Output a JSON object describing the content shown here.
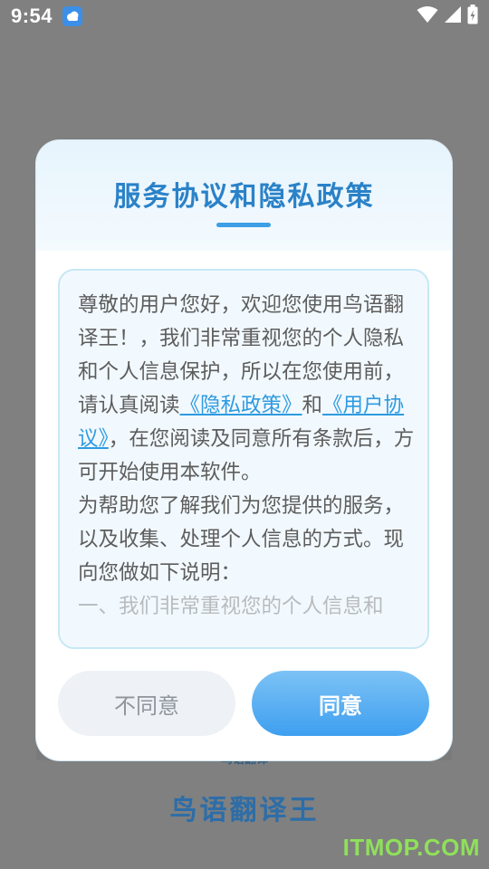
{
  "status_bar": {
    "time": "9:54",
    "icons": [
      "weather-cloud-icon",
      "wifi-icon",
      "signal-icon",
      "battery-icon"
    ]
  },
  "background": {
    "subtitle": "鸟语翻译",
    "app_name": "鸟语翻译王",
    "watermark": "ITMOP.COM"
  },
  "dialog": {
    "title": "服务协议和隐私政策",
    "content": {
      "intro_pre": "尊敬的用户您好，欢迎您使用鸟语翻译王！，我们非常重视您的个人隐私和个人信息保护，所以在您使用前，请认真阅读",
      "privacy_link": "《隐私政策》",
      "and": "和",
      "user_link": "《用户协议》",
      "intro_post": "，在您阅读及同意所有条款后，方可开始使用本软件。",
      "para2": "为帮助您了解我们为您提供的服务，以及收集、处理个人信息的方式。现向您做如下说明：",
      "para3": "一、我们非常重视您的个人信息和"
    },
    "buttons": {
      "disagree": "不同意",
      "agree": "同意"
    }
  },
  "colors": {
    "accent": "#3e9ff0",
    "title": "#2a82c8",
    "link": "#2e9be0"
  }
}
